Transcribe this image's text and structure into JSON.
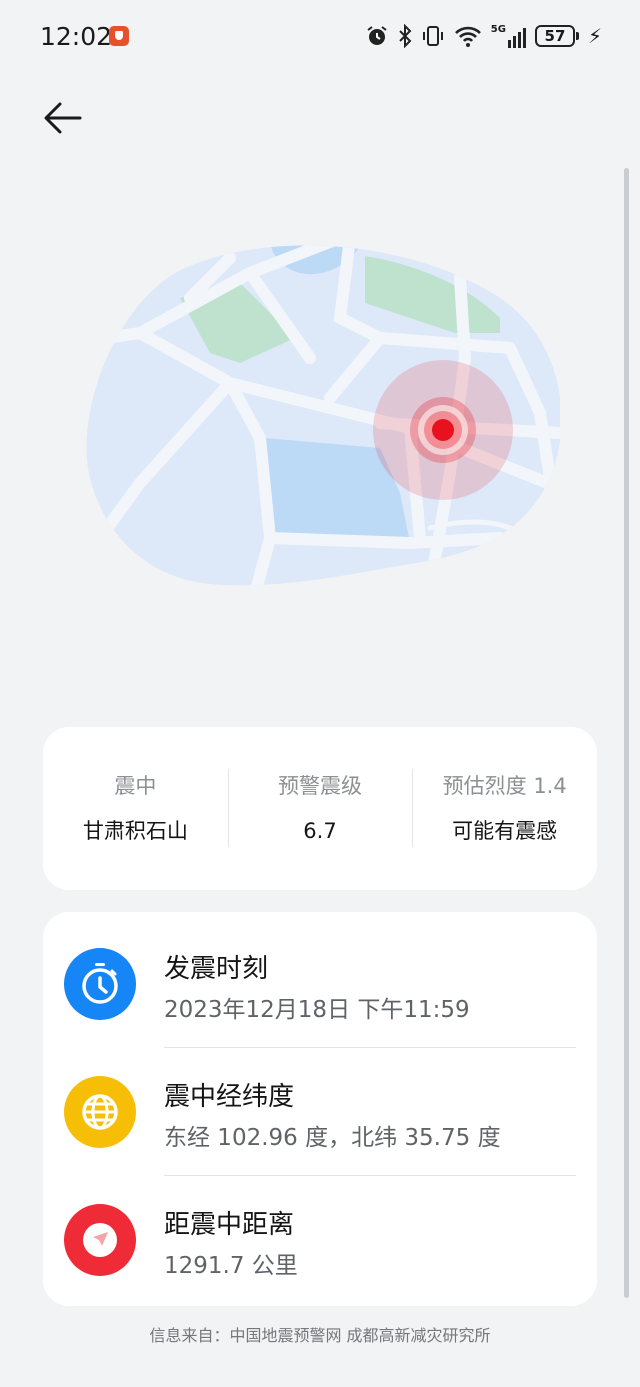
{
  "status_bar": {
    "time": "12:02",
    "network": "5G",
    "battery": "57",
    "icons": [
      "app-notification-icon",
      "alarm-icon",
      "bluetooth-icon",
      "vibrate-icon",
      "wifi-icon",
      "signal-icon",
      "battery-icon",
      "charging-icon"
    ]
  },
  "nav": {
    "back_icon": "arrow-left-icon"
  },
  "map": {
    "marker_color": "#e8121e",
    "water_color": "#bcd9f6",
    "park_color": "#bfe2cf",
    "land_color": "#dde9f8"
  },
  "summary": {
    "epicenter_label": "震中",
    "epicenter_value": "甘肃积石山",
    "magnitude_label": "预警震级",
    "magnitude_value": "6.7",
    "intensity_label": "预估烈度 1.4",
    "intensity_value": "可能有震感"
  },
  "details": [
    {
      "icon": "clock-icon",
      "color": "#1686f6",
      "title": "发震时刻",
      "value": "2023年12月18日 下午11:59"
    },
    {
      "icon": "globe-icon",
      "color": "#f7be08",
      "title": "震中经纬度",
      "value": "东经 102.96 度，北纬 35.75 度"
    },
    {
      "icon": "navigation-icon",
      "color": "#ef2b38",
      "title": "距震中距离",
      "value": "1291.7 公里"
    }
  ],
  "footer": {
    "source": "信息来自：中国地震预警网 成都高新减灾研究所"
  }
}
